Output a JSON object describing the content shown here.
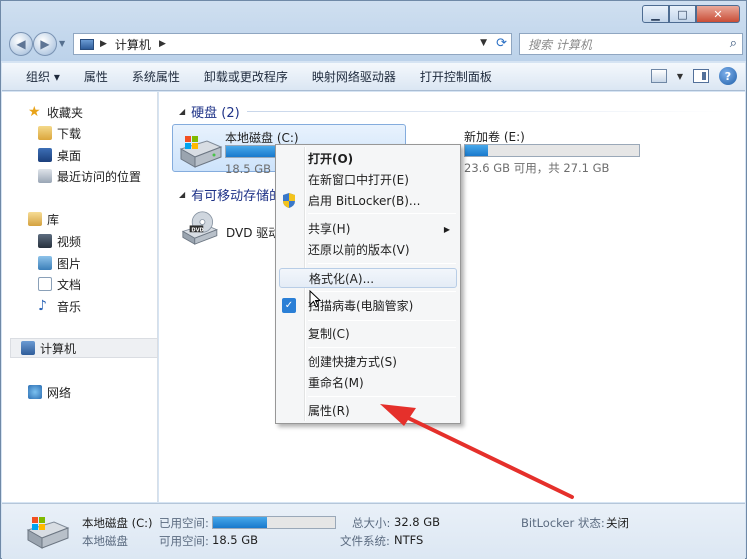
{
  "window": {
    "caption_buttons": [
      "minimize-icon",
      "maximize-icon",
      "close-icon"
    ]
  },
  "address": {
    "segments": [
      "计算机"
    ],
    "search_placeholder": "搜索 计算机"
  },
  "toolbar": {
    "organize": "组织 ▾",
    "properties": "属性",
    "system_properties": "系统属性",
    "uninstall": "卸载或更改程序",
    "map_drive": "映射网络驱动器",
    "control_panel": "打开控制面板"
  },
  "nav": {
    "favorites": "收藏夹",
    "downloads": "下载",
    "desktop": "桌面",
    "recent": "最近访问的位置",
    "libraries": "库",
    "videos": "视频",
    "pictures": "图片",
    "documents": "文档",
    "music": "音乐",
    "computer": "计算机",
    "network": "网络"
  },
  "content": {
    "hard_disks_header": "硬盘 (2)",
    "removable_header": "有可移动存储的",
    "drive_c": {
      "name": "本地磁盘 (C:)",
      "info": "18.5 GB 可",
      "used_fraction": 0.44
    },
    "drive_e": {
      "name": "新加卷 (E:)",
      "info": "23.6 GB 可用，共 27.1 GB",
      "used_fraction": 0.13
    },
    "dvd": {
      "name": "DVD 驱动"
    }
  },
  "context_menu": {
    "open": "打开(O)",
    "open_new_window": "在新窗口中打开(E)",
    "bitlocker": "启用 BitLocker(B)...",
    "share": "共享(H)",
    "restore": "还原以前的版本(V)",
    "format": "格式化(A)...",
    "scan": "扫描病毒(电脑管家)",
    "copy": "复制(C)",
    "shortcut": "创建快捷方式(S)",
    "rename": "重命名(M)",
    "properties": "属性(R)"
  },
  "details": {
    "name": "本地磁盘 (C:)",
    "type": "本地磁盘",
    "used_label": "已用空间:",
    "free_label": "可用空间:",
    "free_value": "18.5 GB",
    "total_label": "总大小:",
    "total_value": "32.8 GB",
    "fs_label": "文件系统:",
    "fs_value": "NTFS",
    "bitlocker_label": "BitLocker 状态:",
    "bitlocker_value": "关闭",
    "used_fraction": 0.44
  },
  "colors": {
    "annotation_arrow": "#e5302b",
    "accent_bar": "#1979cc",
    "group_header": "#1e3287"
  }
}
